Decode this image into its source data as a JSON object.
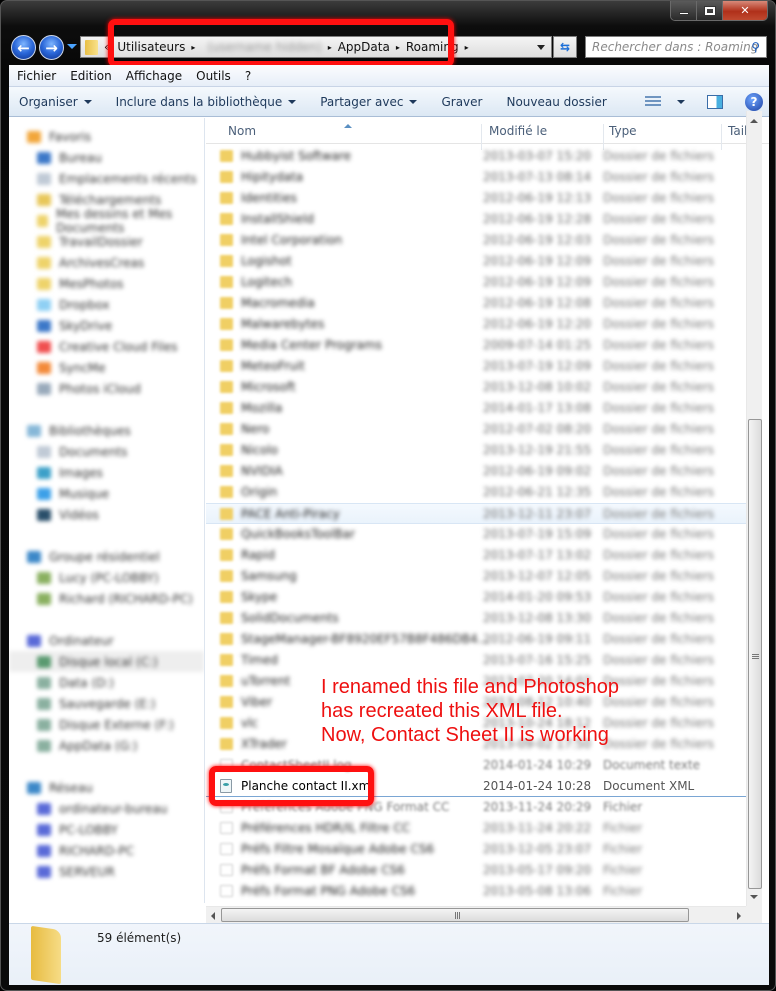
{
  "window": {
    "controls": {
      "minimize": "minimize",
      "maximize": "maximize",
      "close": "close"
    }
  },
  "nav": {
    "back_icon": "back-arrow-icon",
    "forward_icon": "forward-arrow-icon",
    "address": {
      "overflow": "«",
      "segments": [
        "Utilisateurs",
        "(username hidden)",
        "AppData",
        "Roaming"
      ],
      "separator": "▸"
    },
    "search_placeholder": "Rechercher dans : Roaming"
  },
  "menu": [
    "Fichier",
    "Edition",
    "Affichage",
    "Outils",
    "?"
  ],
  "commands": {
    "organiser": "Organiser",
    "include": "Inclure dans la bibliothèque",
    "share": "Partager avec",
    "burn": "Graver",
    "new_folder": "Nouveau dossier"
  },
  "sidebar": {
    "sections": [
      {
        "head": "Favoris",
        "color": "#f2a63a",
        "items": [
          {
            "label": "Bureau",
            "color": "#3c78c8"
          },
          {
            "label": "Emplacements récents",
            "color": "#c0cad6"
          },
          {
            "label": "Téléchargements",
            "color": "#e8c75a"
          },
          {
            "label": "Mes dessins et Mes Documents",
            "color": "#eed36a"
          },
          {
            "label": "TravailDossier",
            "color": "#eed36a"
          },
          {
            "label": "ArchivesCreas",
            "color": "#eed36a"
          },
          {
            "label": "MesPhotos",
            "color": "#eed36a"
          },
          {
            "label": "Dropbox",
            "color": "#8fd0f4"
          },
          {
            "label": "SkyDrive",
            "color": "#3c78c8"
          },
          {
            "label": "Creative Cloud Files",
            "color": "#f05050"
          },
          {
            "label": "SyncMe",
            "color": "#f38a3a"
          },
          {
            "label": "Photos iCloud",
            "color": "#9ab"
          }
        ]
      },
      {
        "head": "Bibliothèques",
        "color": "#86b7d8",
        "items": [
          {
            "label": "Documents",
            "color": "#c0cad6"
          },
          {
            "label": "Images",
            "color": "#3ca0c8"
          },
          {
            "label": "Musique",
            "color": "#3ca0e8"
          },
          {
            "label": "Vidéos",
            "color": "#2a4f6a"
          }
        ]
      },
      {
        "head": "Groupe résidentiel",
        "color": "#3c88c8",
        "items": [
          {
            "label": "Lucy (PC-LOBBY)",
            "color": "#8ab060"
          },
          {
            "label": "Richard (RICHARD-PC)",
            "color": "#8ab060"
          }
        ]
      },
      {
        "head": "Ordinateur",
        "color": "#5a6ad8",
        "items": [
          {
            "label": "Disque local (C:)",
            "color": "#5a9a70",
            "selected": true
          },
          {
            "label": "Data (D:)",
            "color": "#8ab0a0"
          },
          {
            "label": "Sauvegarde (E:)",
            "color": "#8ab0a0"
          },
          {
            "label": "Disque Externe (F:)",
            "color": "#8ab0a0"
          },
          {
            "label": "AppData (G:)",
            "color": "#8ab0a0"
          }
        ]
      },
      {
        "head": "Réseau",
        "color": "#3c88c8",
        "items": [
          {
            "label": "ordinateur-bureau",
            "color": "#5a6ad8"
          },
          {
            "label": "PC-LOBBY",
            "color": "#5a6ad8"
          },
          {
            "label": "RICHARD-PC",
            "color": "#5a6ad8"
          },
          {
            "label": "SERVEUR",
            "color": "#5a6ad8"
          }
        ]
      }
    ]
  },
  "columns": {
    "name": "Nom",
    "modified": "Modifié le",
    "type": "Type",
    "size": "Taille"
  },
  "files": [
    {
      "name": "Hubbyist Software",
      "date": "2013-03-07 15:20",
      "type": "Dossier de fichiers",
      "kind": "folder"
    },
    {
      "name": "Hipitydata",
      "date": "2013-07-13 08:14",
      "type": "Dossier de fichiers",
      "kind": "folder"
    },
    {
      "name": "Identities",
      "date": "2012-06-19 12:13",
      "type": "Dossier de fichiers",
      "kind": "folder"
    },
    {
      "name": "InstallShield",
      "date": "2012-06-19 12:28",
      "type": "Dossier de fichiers",
      "kind": "folder"
    },
    {
      "name": "Intel Corporation",
      "date": "2012-06-19 12:03",
      "type": "Dossier de fichiers",
      "kind": "folder"
    },
    {
      "name": "Logishot",
      "date": "2012-06-19 12:09",
      "type": "Dossier de fichiers",
      "kind": "folder"
    },
    {
      "name": "Logitech",
      "date": "2012-06-19 12:09",
      "type": "Dossier de fichiers",
      "kind": "folder"
    },
    {
      "name": "Macromedia",
      "date": "2012-06-19 12:08",
      "type": "Dossier de fichiers",
      "kind": "folder"
    },
    {
      "name": "Malwarebytes",
      "date": "2012-06-19 12:20",
      "type": "Dossier de fichiers",
      "kind": "folder"
    },
    {
      "name": "Media Center Programs",
      "date": "2009-07-14 01:25",
      "type": "Dossier de fichiers",
      "kind": "folder"
    },
    {
      "name": "MeteoFruit",
      "date": "2013-07-19 12:09",
      "type": "Dossier de fichiers",
      "kind": "folder"
    },
    {
      "name": "Microsoft",
      "date": "2013-12-08 10:02",
      "type": "Dossier de fichiers",
      "kind": "folder"
    },
    {
      "name": "Mozilla",
      "date": "2014-01-17 13:08",
      "type": "Dossier de fichiers",
      "kind": "folder"
    },
    {
      "name": "Nero",
      "date": "2012-07-02 08:20",
      "type": "Dossier de fichiers",
      "kind": "folder"
    },
    {
      "name": "Nicolo",
      "date": "2013-12-19 21:55",
      "type": "Dossier de fichiers",
      "kind": "folder"
    },
    {
      "name": "NVIDIA",
      "date": "2012-06-19 09:02",
      "type": "Dossier de fichiers",
      "kind": "folder"
    },
    {
      "name": "Origin",
      "date": "2012-06-21 12:35",
      "type": "Dossier de fichiers",
      "kind": "folder"
    },
    {
      "name": "PACE Anti-Piracy",
      "date": "2013-12-11 23:07",
      "type": "Dossier de fichiers",
      "kind": "folder",
      "hover": true
    },
    {
      "name": "QuickBooksToolBar",
      "date": "2013-07-19 15:09",
      "type": "Dossier de fichiers",
      "kind": "folder"
    },
    {
      "name": "Rapid",
      "date": "2013-07-17 13:02",
      "type": "Dossier de fichiers",
      "kind": "folder"
    },
    {
      "name": "Samsung",
      "date": "2013-12-07 12:05",
      "type": "Dossier de fichiers",
      "kind": "folder"
    },
    {
      "name": "Skype",
      "date": "2014-01-20 09:53",
      "type": "Dossier de fichiers",
      "kind": "folder"
    },
    {
      "name": "SolidDocuments",
      "date": "2013-12-08 13:30",
      "type": "Dossier de fichiers",
      "kind": "folder"
    },
    {
      "name": "StageManager-BF8920EF57B8F486DB4…",
      "date": "2012-06-19 09:11",
      "type": "Dossier de fichiers",
      "kind": "folder"
    },
    {
      "name": "Timed",
      "date": "2013-07-16 15:25",
      "type": "Dossier de fichiers",
      "kind": "folder"
    },
    {
      "name": "uTorrent",
      "date": "2013-07-20 14:02",
      "type": "Dossier de fichiers",
      "kind": "folder"
    },
    {
      "name": "Viber",
      "date": "2013-08-12 10:40",
      "type": "Dossier de fichiers",
      "kind": "folder"
    },
    {
      "name": "vlc",
      "date": "2013-10-24 18:12",
      "type": "Dossier de fichiers",
      "kind": "folder"
    },
    {
      "name": "XTrader",
      "date": "2013-09-02 17:50",
      "type": "Dossier de fichiers",
      "kind": "folder"
    },
    {
      "name": "ContactSheetII.log",
      "date": "2014-01-24 10:29",
      "type": "Document texte",
      "kind": "file",
      "style": "semi"
    },
    {
      "name": "Planche contact II.xml",
      "date": "2014-01-24 10:28",
      "type": "Document XML",
      "kind": "xml",
      "style": "clear"
    },
    {
      "name": "Préférences Adobe PNG Format CC",
      "date": "2013-11-24 20:29",
      "type": "Fichier",
      "kind": "file",
      "style": "semi"
    },
    {
      "name": "Préférences HDR/IL Filtre CC",
      "date": "2013-11-24 20:22",
      "type": "Fichier",
      "kind": "file"
    },
    {
      "name": "Préfs Filtre Mosaïque Adobe CS6",
      "date": "2013-12-05 23:07",
      "type": "Fichier",
      "kind": "file"
    },
    {
      "name": "Préfs Format BF Adobe CS6",
      "date": "2013-05-17 09:20",
      "type": "Fichier",
      "kind": "file"
    },
    {
      "name": "Préfs Format PNG Adobe CS6",
      "date": "2013-05-08 13:06",
      "type": "Fichier",
      "kind": "file"
    }
  ],
  "annotation": {
    "lines": [
      "I renamed this file and Photoshop",
      "has recreated this XML file.",
      "Now,  Contact Sheet II is working"
    ],
    "color": "#ee1010"
  },
  "status": {
    "count": "59 élément(s)"
  }
}
